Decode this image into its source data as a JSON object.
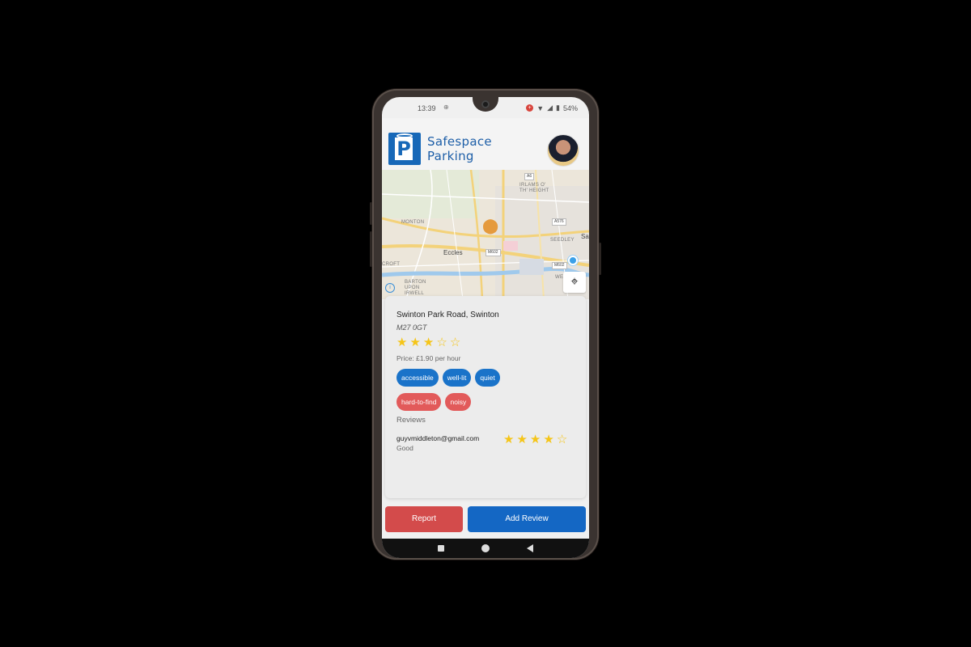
{
  "status_bar": {
    "time": "13:39",
    "battery": "54%"
  },
  "app": {
    "brand_line1": "Safespace",
    "brand_line2": "Parking",
    "logo_letter": "P"
  },
  "map": {
    "labels": [
      "Eccles",
      "MONTON",
      "IRLAMS O' TH' HEIGHT",
      "SEEDLEY",
      "BARTON UPON IRWELL",
      "CROFT",
      "Sa",
      "WE"
    ],
    "road_signs": [
      "A6",
      "A576",
      "M602",
      "M602"
    ]
  },
  "spot": {
    "address": "Swinton Park Road, Swinton",
    "postcode": "M27 0GT",
    "rating": 3,
    "max_rating": 5,
    "price": "Price: £1.90 per hour",
    "positive_tags": [
      "accessible",
      "well-lit",
      "quiet"
    ],
    "negative_tags": [
      "hard-to-find",
      "noisy"
    ],
    "reviews_heading": "Reviews",
    "reviews": [
      {
        "email": "guyvmiddleton@gmail.com",
        "text": "Good",
        "rating": 4
      }
    ]
  },
  "actions": {
    "report_label": "Report",
    "add_review_label": "Add Review"
  },
  "colors": {
    "brand_blue": "#1768b8",
    "positive_tag": "#1a73c9",
    "negative_tag": "#e25a5a",
    "report": "#d34b4b",
    "add_review": "#1467c4",
    "star": "#f5c518"
  },
  "icons": {
    "recenter": "crosshair-icon",
    "pin": "map-pin-icon",
    "location": "current-location-icon",
    "info": "info-icon"
  }
}
